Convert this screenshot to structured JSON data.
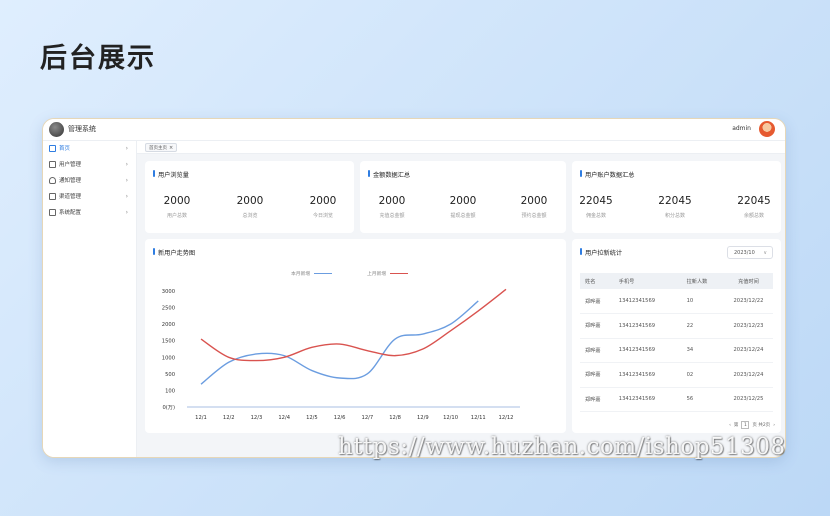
{
  "page_heading": "后台展示",
  "app": {
    "title": "管理系统",
    "user": "admin"
  },
  "sidebar": {
    "items": [
      {
        "label": "首页",
        "icon": "home-icon"
      },
      {
        "label": "用户管理",
        "icon": "user-icon"
      },
      {
        "label": "通知管理",
        "icon": "bell-icon"
      },
      {
        "label": "渠道管理",
        "icon": "channel-icon"
      },
      {
        "label": "系统配置",
        "icon": "settings-icon"
      }
    ]
  },
  "tabs": [
    {
      "label": "首页主页"
    }
  ],
  "cards": {
    "browse": {
      "title": "用户浏览量",
      "stats": [
        {
          "value": "2000",
          "label": "用户总数"
        },
        {
          "value": "2000",
          "label": "总浏览"
        },
        {
          "value": "2000",
          "label": "今日浏览"
        }
      ]
    },
    "amount": {
      "title": "金额数据汇总",
      "stats": [
        {
          "value": "2000",
          "label": "充值总金额"
        },
        {
          "value": "2000",
          "label": "提现总金额"
        },
        {
          "value": "2000",
          "label": "预约总金额"
        }
      ]
    },
    "account": {
      "title": "用户账户数据汇总",
      "stats": [
        {
          "value": "22045",
          "label": "佣金总数"
        },
        {
          "value": "22045",
          "label": "积分总数"
        },
        {
          "value": "22045",
          "label": "余额总数"
        }
      ]
    },
    "trend": {
      "title": "新用户走势图"
    },
    "ranking": {
      "title": "用户拉新统计",
      "select_value": "2023/10",
      "columns": [
        "姓名",
        "手机号",
        "拉新人数",
        "充值时间"
      ],
      "rows": [
        [
          "郑晔嘉",
          "13412341569",
          "10",
          "2023/12/22"
        ],
        [
          "郑晔嘉",
          "13412341569",
          "22",
          "2023/12/23"
        ],
        [
          "郑晔嘉",
          "13412341569",
          "34",
          "2023/12/24"
        ],
        [
          "郑晔嘉",
          "13412341569",
          "02",
          "2023/12/24"
        ],
        [
          "郑晔嘉",
          "13412341569",
          "56",
          "2023/12/25"
        ]
      ],
      "pager": {
        "prefix": "第",
        "page": "1",
        "suffix": "页 共2页"
      }
    }
  },
  "chart_data": {
    "type": "line",
    "categories": [
      "12/1",
      "12/2",
      "12/3",
      "12/4",
      "12/5",
      "12/6",
      "12/7",
      "12/8",
      "12/9",
      "12/10",
      "12/11",
      "12/12"
    ],
    "y_ticks": [
      "3000",
      "2500",
      "2000",
      "1500",
      "1000",
      "500",
      "100",
      "0(万)"
    ],
    "y_tick_values": [
      3000,
      2500,
      2000,
      1500,
      1000,
      500,
      100,
      0
    ],
    "ylim": [
      0,
      3000
    ],
    "series": [
      {
        "name": "本月新增",
        "color": "#6b9de0",
        "values": [
          250,
          850,
          1100,
          1050,
          600,
          400,
          500,
          1550,
          1700,
          2000,
          2700
        ]
      },
      {
        "name": "上月新增",
        "color": "#d9534f",
        "values": [
          1550,
          1000,
          900,
          1000,
          1300,
          1400,
          1200,
          1050,
          1250,
          1800,
          2400,
          3050
        ]
      }
    ],
    "grid": false,
    "legend": "top-center"
  },
  "watermark": "https://www.huzhan.com/ishop51308"
}
